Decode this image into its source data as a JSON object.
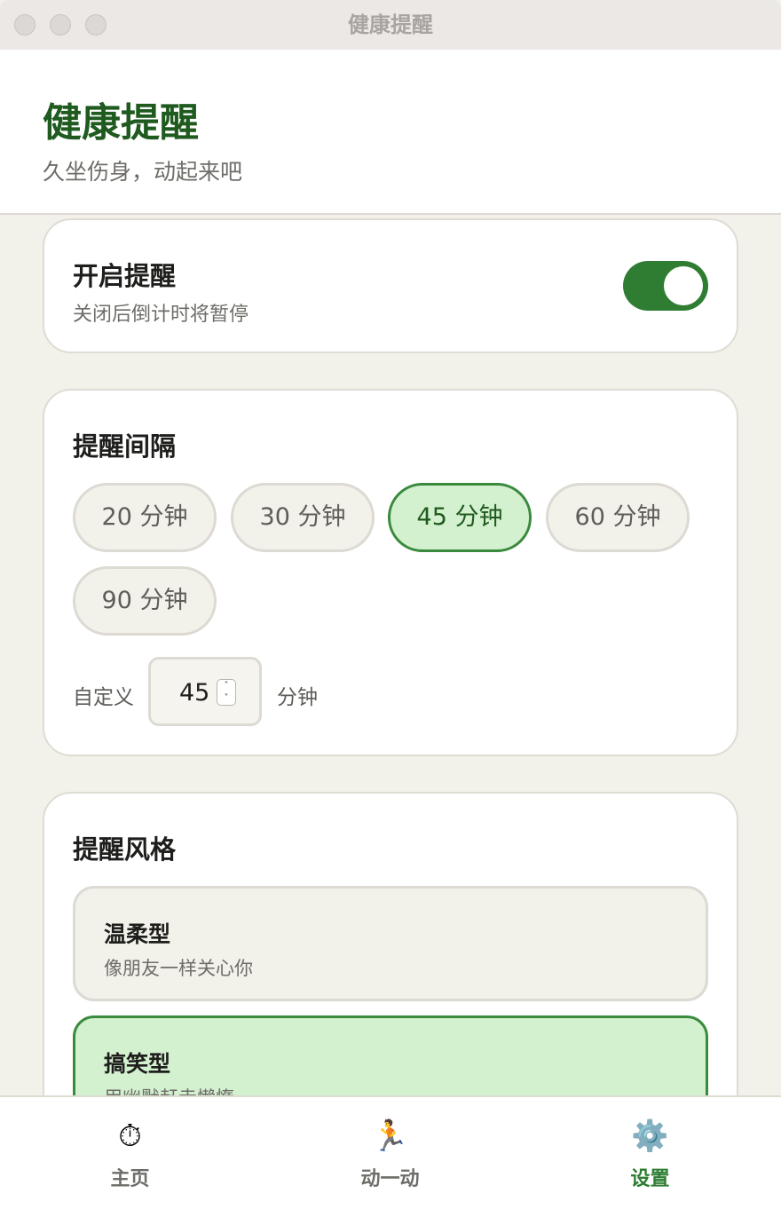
{
  "window": {
    "title": "健康提醒"
  },
  "header": {
    "title": "健康提醒",
    "subtitle": "久坐伤身，动起来吧"
  },
  "toggle_card": {
    "title": "开启提醒",
    "subtitle": "关闭后倒计时将暂停",
    "enabled": true
  },
  "interval_card": {
    "title": "提醒间隔",
    "options": [
      "20 分钟",
      "30 分钟",
      "45 分钟",
      "60 分钟",
      "90 分钟"
    ],
    "selected": "45 分钟",
    "custom_label": "自定义",
    "custom_value": "45",
    "unit_label": "分钟"
  },
  "style_card": {
    "title": "提醒风格",
    "options": [
      {
        "title": "温柔型",
        "desc": "像朋友一样关心你"
      },
      {
        "title": "搞笑型",
        "desc": "用幽默赶走懒惰"
      }
    ],
    "selected": "搞笑型"
  },
  "tabbar": {
    "items": [
      {
        "label": "主页",
        "icon": "⏱"
      },
      {
        "label": "动一动",
        "icon": "🏃"
      },
      {
        "label": "设置",
        "icon": "⚙️"
      }
    ],
    "active": "设置"
  },
  "colors": {
    "accent": "#2e7d32",
    "accent_light": "#d3f0cf",
    "title_green": "#1f5a1f",
    "background": "#f2f1ea"
  }
}
